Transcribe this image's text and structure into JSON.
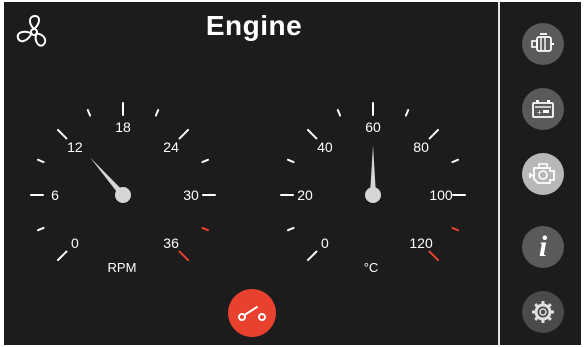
{
  "header": {
    "title": "Engine",
    "fan_icon": "fan-icon"
  },
  "rpm_gauge": {
    "unit": "RPM",
    "labels": [
      "0",
      "6",
      "12",
      "18",
      "24",
      "30",
      "36"
    ],
    "needle_value": 12.5,
    "max": 36,
    "redline_from": 33
  },
  "temp_gauge": {
    "unit": "°C",
    "labels": [
      "0",
      "20",
      "40",
      "60",
      "80",
      "100",
      "120"
    ],
    "needle_value": 60,
    "max": 120,
    "redline_from": 100
  },
  "controls": {
    "toggle_icon": "switch-icon"
  },
  "sidebar": {
    "items": [
      {
        "name": "generator",
        "icon": "generator-icon",
        "active": false
      },
      {
        "name": "battery",
        "icon": "battery-icon",
        "active": false
      },
      {
        "name": "engine",
        "icon": "engine-icon",
        "active": true
      },
      {
        "name": "info",
        "icon": "info-icon",
        "active": false
      },
      {
        "name": "settings",
        "icon": "gear-icon",
        "active": false
      }
    ]
  },
  "colors": {
    "background": "#1c1c1c",
    "accent_red": "#e8422e",
    "divider": "#e6e6e6"
  }
}
